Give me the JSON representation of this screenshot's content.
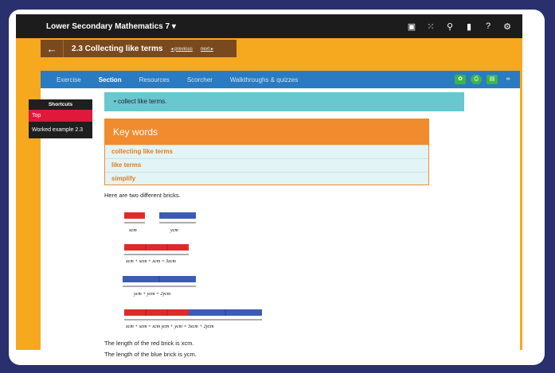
{
  "topbar": {
    "title": "Lower Secondary Mathematics 7 ▾",
    "icons": [
      "notes-icon",
      "grid-icon",
      "search-icon",
      "book-icon",
      "help-icon",
      "gear-icon"
    ]
  },
  "chapter": {
    "back": "←",
    "title": "2.3 Collecting like terms",
    "previous": "◂ previous",
    "next": "next ▸"
  },
  "nav": {
    "tabs": [
      "Exercise",
      "Section",
      "Resources",
      "Scorcher",
      "Walkthroughs & quizzes"
    ],
    "active": "Section"
  },
  "shortcuts": {
    "heading": "Shortcuts",
    "top": "Top",
    "worked": "Worked example 2.3"
  },
  "objective": "•   collect like terms.",
  "keywords": {
    "heading": "Key words",
    "items": [
      "collecting like terms",
      "like terms",
      "simplify"
    ]
  },
  "body": {
    "intro": "Here are two different bricks.",
    "red_len": "The length of the red brick is xcm.",
    "blue_len": "The length of the blue brick is ycm."
  },
  "diagram": {
    "l1a": "xcm",
    "l1b": "ycm",
    "l2": "xcm + xcm + xcm    = 3xcm",
    "l3": "ycm     +     ycm     = 2ycm",
    "l4": "xcm + xcm + xcm       ycm     +     ycm       = 3xcm + 2ycm"
  },
  "colors": {
    "red": "#e02a2a",
    "blue": "#3b5bb5",
    "orange": "#f08c2e",
    "yellow": "#f6a81e"
  }
}
